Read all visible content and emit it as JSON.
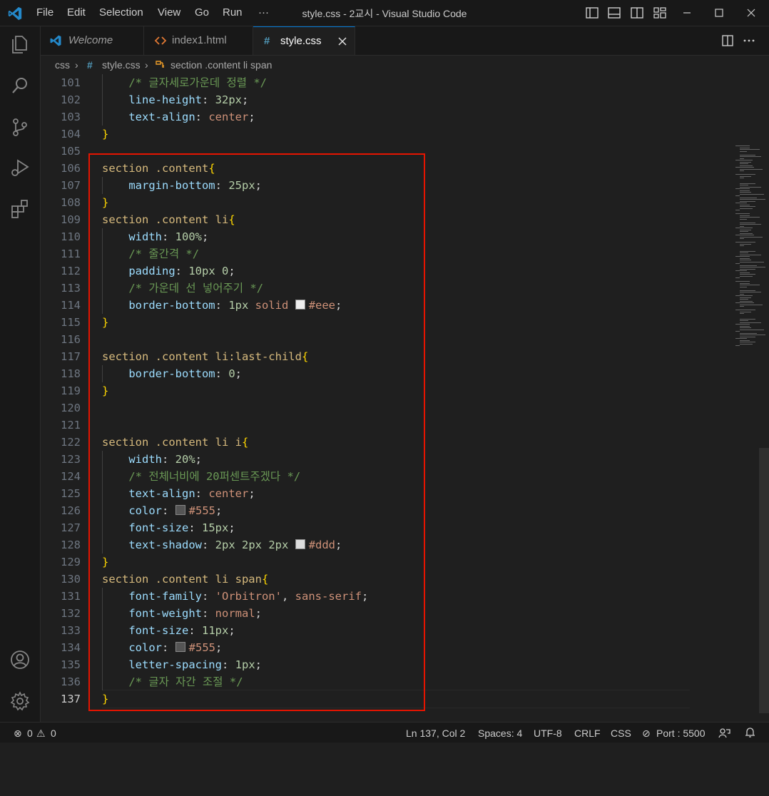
{
  "window": {
    "title": "style.css - 2교시 - Visual Studio Code",
    "menu": [
      "File",
      "Edit",
      "Selection",
      "View",
      "Go",
      "Run",
      "···"
    ],
    "controls": [
      "toggle-primary-sidebar-icon",
      "toggle-panel-icon",
      "toggle-secondary-sidebar-icon",
      "customize-layout-icon",
      "minimize-icon",
      "maximize-icon",
      "close-icon"
    ]
  },
  "activity_bar": [
    "explorer-icon",
    "search-icon",
    "source-control-icon",
    "run-debug-icon",
    "extensions-icon",
    "accounts-icon",
    "manage-gear-icon"
  ],
  "tabs": [
    {
      "label": "Welcome",
      "icon": "vscode-icon",
      "active": false
    },
    {
      "label": "index1.html",
      "icon": "html-icon",
      "active": false
    },
    {
      "label": "style.css",
      "icon": "css-hash-icon",
      "active": true
    }
  ],
  "tab_actions": [
    "split-editor-icon",
    "more-actions-icon"
  ],
  "breadcrumb": {
    "folder": "css",
    "file": "style.css",
    "symbol": "section .content li span"
  },
  "editor": {
    "lines": [
      {
        "n": "101",
        "text": "    /* 글자세로가운데 정렬 */"
      },
      {
        "n": "102",
        "text": "    line-height: 32px;"
      },
      {
        "n": "103",
        "text": "    text-align: center;"
      },
      {
        "n": "104",
        "text": "}"
      },
      {
        "n": "105",
        "text": ""
      },
      {
        "n": "106",
        "text": "section .content{"
      },
      {
        "n": "107",
        "text": "    margin-bottom: 25px;"
      },
      {
        "n": "108",
        "text": "}"
      },
      {
        "n": "109",
        "text": "section .content li{"
      },
      {
        "n": "110",
        "text": "    width: 100%;"
      },
      {
        "n": "111",
        "text": "    /* 줄간격 */"
      },
      {
        "n": "112",
        "text": "    padding: 10px 0;"
      },
      {
        "n": "113",
        "text": "    /* 가운데 선 넣어주기 */"
      },
      {
        "n": "114",
        "text": "    border-bottom: 1px solid #eee;"
      },
      {
        "n": "115",
        "text": "}"
      },
      {
        "n": "116",
        "text": ""
      },
      {
        "n": "117",
        "text": "section .content li:last-child{"
      },
      {
        "n": "118",
        "text": "    border-bottom: 0;"
      },
      {
        "n": "119",
        "text": "}"
      },
      {
        "n": "120",
        "text": ""
      },
      {
        "n": "121",
        "text": ""
      },
      {
        "n": "122",
        "text": "section .content li i{"
      },
      {
        "n": "123",
        "text": "    width: 20%;"
      },
      {
        "n": "124",
        "text": "    /* 전체너비에 20퍼센트주겠다 */"
      },
      {
        "n": "125",
        "text": "    text-align: center;"
      },
      {
        "n": "126",
        "text": "    color: #555;"
      },
      {
        "n": "127",
        "text": "    font-size: 15px;"
      },
      {
        "n": "128",
        "text": "    text-shadow: 2px 2px 2px #ddd;"
      },
      {
        "n": "129",
        "text": "}"
      },
      {
        "n": "130",
        "text": "section .content li span{"
      },
      {
        "n": "131",
        "text": "    font-family: 'Orbitron', sans-serif;"
      },
      {
        "n": "132",
        "text": "    font-weight: normal;"
      },
      {
        "n": "133",
        "text": "    font-size: 11px;"
      },
      {
        "n": "134",
        "text": "    color: #555;"
      },
      {
        "n": "135",
        "text": "    letter-spacing: 1px;"
      },
      {
        "n": "136",
        "text": "    /* 글자 자간 조절 */"
      },
      {
        "n": "137",
        "text": "}"
      }
    ],
    "current_line": "137",
    "color_swatches": {
      "114": "#eeeeee",
      "126": "#555555",
      "128": "#dddddd",
      "134": "#555555"
    }
  },
  "status_bar": {
    "errors": "0",
    "warnings": "0",
    "position": "Ln 137, Col 2",
    "spaces": "Spaces: 4",
    "encoding": "UTF-8",
    "eol": "CRLF",
    "language": "CSS",
    "port": "Port : 5500"
  },
  "colors": {
    "accent": "#0078d4",
    "annotation": "#e51400",
    "selector": "#d7ba7d",
    "property": "#9cdcfe",
    "number": "#b5cea8",
    "string_value": "#ce9178",
    "comment": "#6a9955",
    "bracket": "#ffd700"
  }
}
